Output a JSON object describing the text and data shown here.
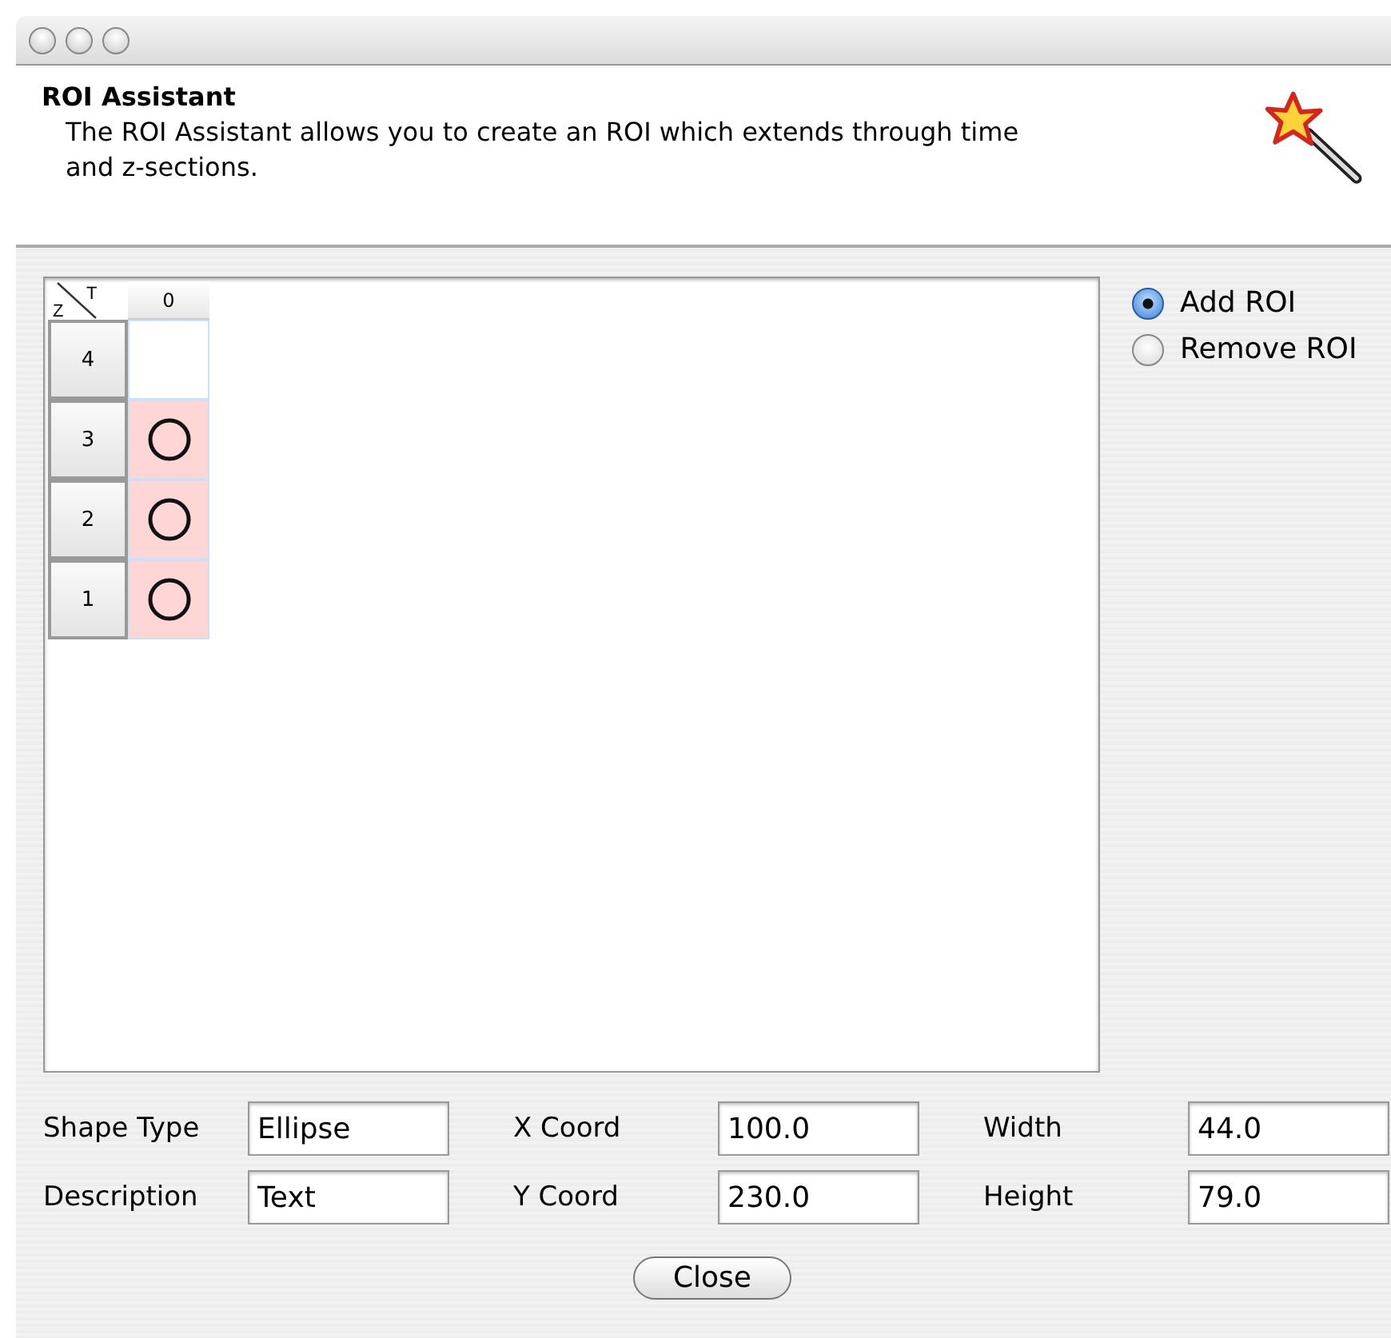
{
  "header": {
    "title": "ROI Assistant",
    "description": "The ROI Assistant allows you to create an ROI which extends through time and z-sections."
  },
  "grid": {
    "corner": {
      "z": "Z",
      "t": "T"
    },
    "columns": [
      "0"
    ],
    "rows": [
      {
        "label": "4",
        "roi": false
      },
      {
        "label": "3",
        "roi": true
      },
      {
        "label": "2",
        "roi": true
      },
      {
        "label": "1",
        "roi": true
      }
    ]
  },
  "mode": [
    {
      "label": "Add ROI",
      "selected": true
    },
    {
      "label": "Remove ROI",
      "selected": false
    }
  ],
  "fields": [
    {
      "label": "Shape Type",
      "value": "Ellipse"
    },
    {
      "label": "X Coord",
      "value": "100.0"
    },
    {
      "label": "Width",
      "value": "44.0"
    },
    {
      "label": "Description",
      "value": "Text"
    },
    {
      "label": "Y Coord",
      "value": "230.0"
    },
    {
      "label": "Height",
      "value": "79.0"
    }
  ],
  "buttons": [
    "Close"
  ]
}
